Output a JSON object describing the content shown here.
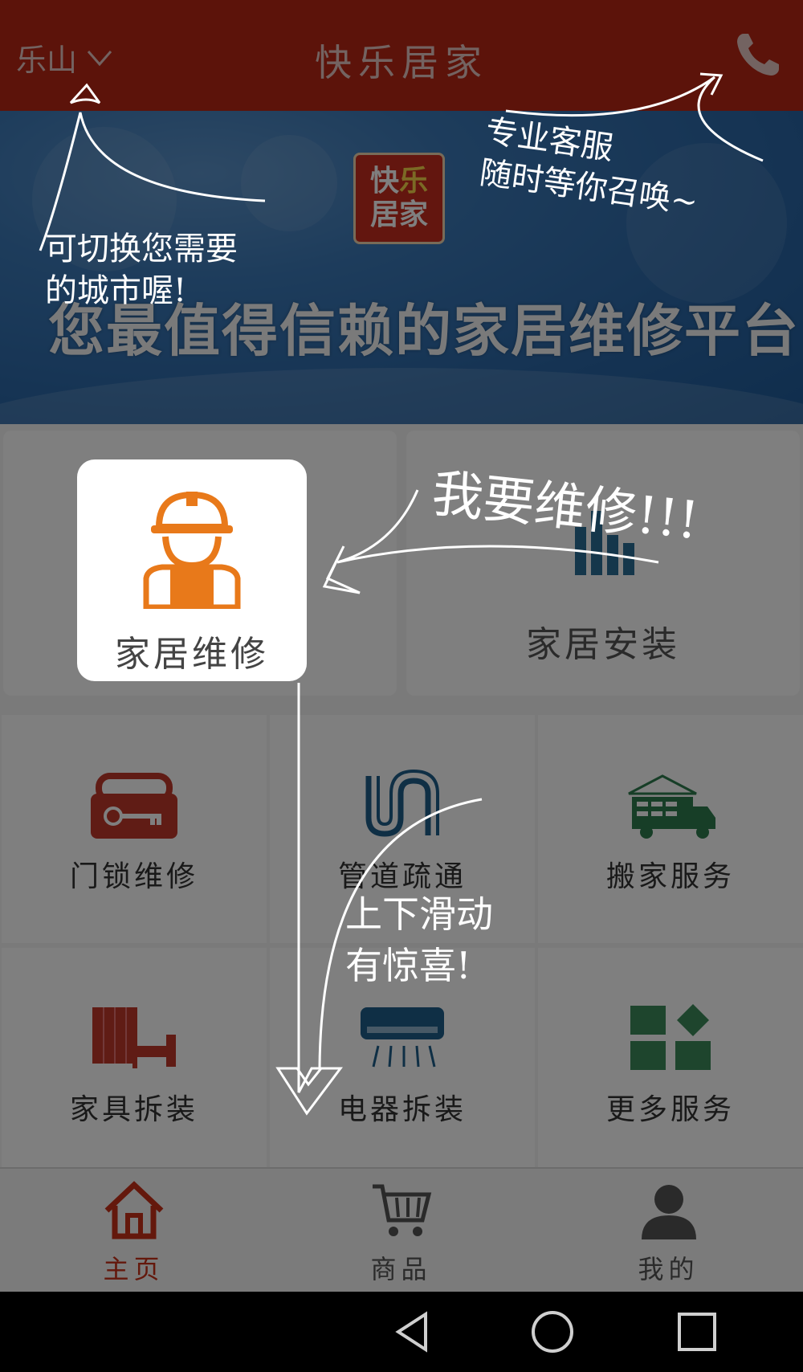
{
  "header": {
    "city": "乐山",
    "title": "快乐居家"
  },
  "banner": {
    "logo_line1_a": "快",
    "logo_line1_b": "乐",
    "logo_line2": "居家",
    "slogan": "您最值得信赖的家居维修平台"
  },
  "services": {
    "featured": [
      {
        "label": "家居维修",
        "icon": "worker-icon"
      },
      {
        "label": "家居安装",
        "icon": "install-icon"
      }
    ],
    "grid": [
      {
        "label": "门锁维修",
        "icon": "key-lock-icon"
      },
      {
        "label": "管道疏通",
        "icon": "pipe-icon"
      },
      {
        "label": "搬家服务",
        "icon": "moving-truck-icon"
      },
      {
        "label": "家具拆装",
        "icon": "furniture-icon"
      },
      {
        "label": "电器拆装",
        "icon": "air-conditioner-icon"
      },
      {
        "label": "更多服务",
        "icon": "more-grid-icon"
      }
    ]
  },
  "bottom_nav": [
    {
      "label": "主页",
      "icon": "home-icon",
      "active": true
    },
    {
      "label": "商品",
      "icon": "cart-icon",
      "active": false
    },
    {
      "label": "我的",
      "icon": "user-icon",
      "active": false
    }
  ],
  "guide": {
    "city_tip": "可切换您需要\n的城市喔!",
    "phone_tip": "专业客服\n随时等你召唤~",
    "repair_tip": "我要维修!!!",
    "scroll_tip": "上下滑动\n有惊喜!"
  },
  "colors": {
    "header_bg": "#b82615",
    "accent": "#e8791a",
    "active_nav": "#c83019",
    "overlay": "rgba(0,0,0,0.5)"
  }
}
